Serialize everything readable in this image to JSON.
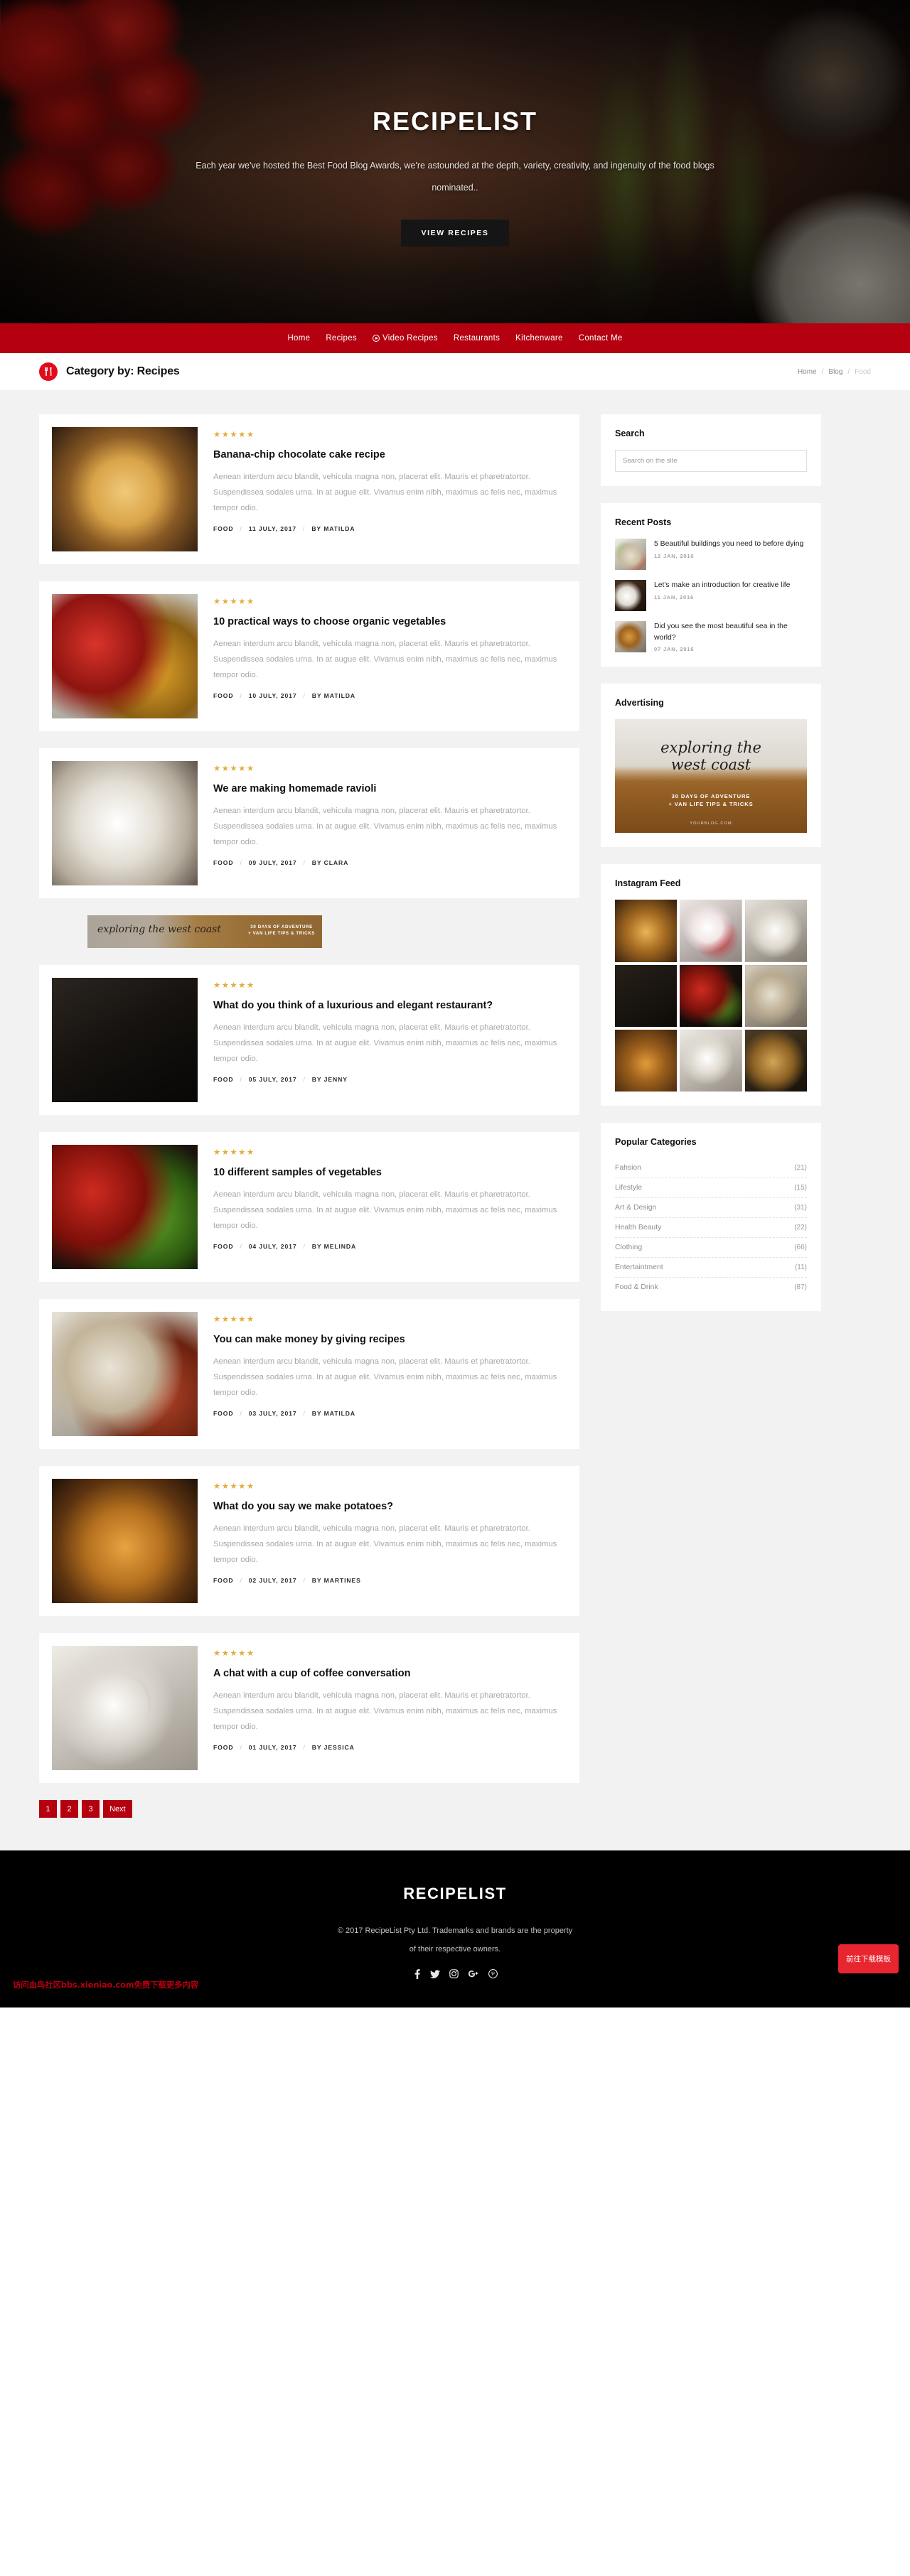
{
  "hero": {
    "title": "RECIPELIST",
    "subtitle": "Each year we've hosted the Best Food Blog Awards, we're astounded at the depth, variety, creativity, and ingenuity of the food blogs nominated..",
    "cta": "VIEW RECIPES"
  },
  "nav": {
    "items": [
      {
        "label": "Home",
        "icon": null
      },
      {
        "label": "Recipes",
        "icon": null
      },
      {
        "label": "Video Recipes",
        "icon": "play-circle-icon"
      },
      {
        "label": "Restaurants",
        "icon": null
      },
      {
        "label": "Kitchenware",
        "icon": null
      },
      {
        "label": "Contact Me",
        "icon": null
      }
    ]
  },
  "titlebar": {
    "badge_icon": "fork-knife-icon",
    "title": "Category by: Recipes",
    "breadcrumb": [
      {
        "label": "Home",
        "current": false
      },
      {
        "label": "Blog",
        "current": false
      },
      {
        "label": "Food",
        "current": true
      }
    ],
    "separator": "/"
  },
  "excerpt_default": "Aenean interdum arcu blandit, vehicula magna non, placerat elit. Mauris et pharetratortor. Suspendissea sodales urna. In at augue elit. Vivamus enim nibh, maximus ac felis nec, maximus tempor odio.",
  "stars_glyph": "★★★★★",
  "posts": [
    {
      "title": "Banana-chip chocolate cake recipe",
      "excerpt": "Aenean interdum arcu blandit, vehicula magna non, placerat elit. Mauris et pharetratortor. Suspendissea sodales urna. In at augue elit. Vivamus enim nibh, maximus ac felis nec, maximus tempor odio.",
      "category": "FOOD",
      "date": "11 JULY, 2017",
      "author": "BY MATILDA",
      "rating": 5
    },
    {
      "title": "10 practical ways to choose organic vegetables",
      "excerpt": "Aenean interdum arcu blandit, vehicula magna non, placerat elit. Mauris et pharetratortor. Suspendissea sodales urna. In at augue elit. Vivamus enim nibh, maximus ac felis nec, maximus tempor odio.",
      "category": "FOOD",
      "date": "10 JULY, 2017",
      "author": "BY MATILDA",
      "rating": 5
    },
    {
      "title": "We are making homemade ravioli",
      "excerpt": "Aenean interdum arcu blandit, vehicula magna non, placerat elit. Mauris et pharetratortor. Suspendissea sodales urna. In at augue elit. Vivamus enim nibh, maximus ac felis nec, maximus tempor odio.",
      "category": "FOOD",
      "date": "09 JULY, 2017",
      "author": "BY CLARA",
      "rating": 5
    },
    {
      "title": "What do you think of a luxurious and elegant restaurant?",
      "excerpt": "Aenean interdum arcu blandit, vehicula magna non, placerat elit. Mauris et pharetratortor. Suspendissea sodales urna. In at augue elit. Vivamus enim nibh, maximus ac felis nec, maximus tempor odio.",
      "category": "FOOD",
      "date": "05 JULY, 2017",
      "author": "BY JENNY",
      "rating": 5
    },
    {
      "title": "10 different samples of vegetables",
      "excerpt": "Aenean interdum arcu blandit, vehicula magna non, placerat elit. Mauris et pharetratortor. Suspendissea sodales urna. In at augue elit. Vivamus enim nibh, maximus ac felis nec, maximus tempor odio.",
      "category": "FOOD",
      "date": "04 JULY, 2017",
      "author": "BY MELINDA",
      "rating": 5
    },
    {
      "title": "You can make money by giving recipes",
      "excerpt": "Aenean interdum arcu blandit, vehicula magna non, placerat elit. Mauris et pharetratortor. Suspendissea sodales urna. In at augue elit. Vivamus enim nibh, maximus ac felis nec, maximus tempor odio.",
      "category": "FOOD",
      "date": "03 JULY, 2017",
      "author": "BY MATILDA",
      "rating": 5
    },
    {
      "title": "What do you say we make potatoes?",
      "excerpt": "Aenean interdum arcu blandit, vehicula magna non, placerat elit. Mauris et pharetratortor. Suspendissea sodales urna. In at augue elit. Vivamus enim nibh, maximus ac felis nec, maximus tempor odio.",
      "category": "FOOD",
      "date": "02 JULY, 2017",
      "author": "BY MARTINES",
      "rating": 5
    },
    {
      "title": "A chat with a cup of coffee conversation",
      "excerpt": "Aenean interdum arcu blandit, vehicula magna non, placerat elit. Mauris et pharetratortor. Suspendissea sodales urna. In at augue elit. Vivamus enim nibh, maximus ac felis nec, maximus tempor odio.",
      "category": "FOOD",
      "date": "01 JULY, 2017",
      "author": "BY JESSICA",
      "rating": 5
    }
  ],
  "inline_banner": {
    "script_text": "exploring the west coast",
    "sub_line1": "30 DAYS OF ADVENTURE",
    "sub_line2": "+ VAN LIFE TIPS & TRICKS"
  },
  "pagination": {
    "pages": [
      "1",
      "2",
      "3"
    ],
    "next_label": "Next"
  },
  "sidebar": {
    "search": {
      "title": "Search",
      "placeholder": "Search on the site",
      "value": ""
    },
    "recent": {
      "title": "Recent Posts",
      "items": [
        {
          "title": "5 Beautiful buildings you need to before dying",
          "date": "12 JAN, 2016"
        },
        {
          "title": "Let's make an introduction for creative life",
          "date": "11 JAN, 2016"
        },
        {
          "title": "Did you see the most beautiful sea in the world?",
          "date": "07 JAN, 2016"
        }
      ]
    },
    "advertising": {
      "title": "Advertising",
      "script_line1": "exploring the",
      "script_line2": "west coast",
      "sub_line1": "30 DAYS OF ADVENTURE",
      "sub_line2": "+ VAN LIFE TIPS & TRICKS",
      "url": "YOURBLOG.COM"
    },
    "instagram": {
      "title": "Instagram Feed",
      "cell_count": 9
    },
    "categories": {
      "title": "Popular Categories",
      "items": [
        {
          "label": "Fahsion",
          "count": "(21)"
        },
        {
          "label": "Lifestyle",
          "count": "(15)"
        },
        {
          "label": "Art & Design",
          "count": "(31)"
        },
        {
          "label": "Health Beauty",
          "count": "(22)"
        },
        {
          "label": "Clothing",
          "count": "(66)"
        },
        {
          "label": "Entertaintment",
          "count": "(11)"
        },
        {
          "label": "Food & Drink",
          "count": "(87)"
        }
      ]
    }
  },
  "footer": {
    "logo": "RECIPELIST",
    "copy_line1": "© 2017 RecipeList Pty Ltd. Trademarks and brands are the property",
    "copy_line2": "of their respective owners.",
    "socials": [
      "facebook-icon",
      "twitter-icon",
      "instagram-icon",
      "google-plus-icon",
      "pinterest-icon"
    ],
    "watermark": "访问血鸟社区bbs.xieniao.com免费下载更多内容",
    "download_button": "前往下载模板"
  },
  "colors": {
    "brand_red": "#b4000f",
    "badge_red": "#e00e1c",
    "star_gold": "#e3ad3c",
    "page_bg": "#f2f2f2",
    "footer_bg": "#000000"
  }
}
